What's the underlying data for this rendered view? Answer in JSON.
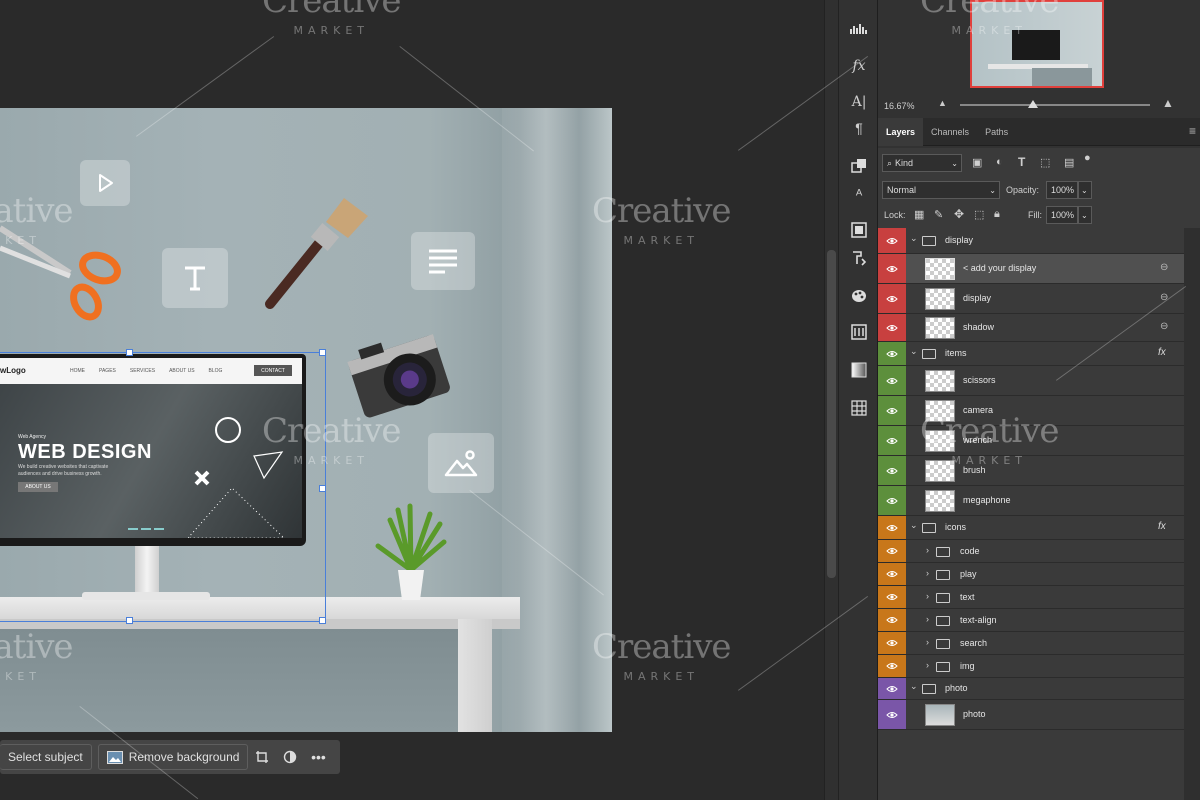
{
  "document": {
    "website": {
      "logo": "wLogo",
      "nav_links": [
        "HOME",
        "PAGES",
        "SERVICES",
        "ABOUT US",
        "BLOG"
      ],
      "contact": "CONTACT",
      "eyebrow": "Web Agency",
      "headline": "WEB DESIGN",
      "subtext": "We build creative websites that captivate audiences and drive business growth.",
      "cta": "ABOUT US"
    },
    "icon_tiles": [
      "play-icon",
      "text-icon",
      "text-align-icon",
      "image-icon"
    ]
  },
  "context_bar": {
    "select_subject": "Select subject",
    "remove_background": "Remove background",
    "more": "•••"
  },
  "watermark": {
    "title": "Creative",
    "sub": "MARKET"
  },
  "navigator": {
    "zoom": "16.67%"
  },
  "panel_tabs": [
    "Layers",
    "Channels",
    "Paths"
  ],
  "filters": {
    "kind": "Kind",
    "blend_mode": "Normal",
    "opacity_label": "Opacity:",
    "opacity": "100%",
    "lock_label": "Lock:",
    "fill_label": "Fill:",
    "fill": "100%"
  },
  "layers": [
    {
      "name": "display",
      "type": "group",
      "color": "#c8403f",
      "expanded": true
    },
    {
      "name": "< add your display",
      "type": "smart",
      "color": "#c8403f",
      "selected": true,
      "linked": true
    },
    {
      "name": "display",
      "type": "layer",
      "color": "#c8403f",
      "linked": true
    },
    {
      "name": "shadow",
      "type": "layer",
      "color": "#c8403f",
      "linked": true
    },
    {
      "name": "items",
      "type": "group",
      "color": "#5d8f3c",
      "expanded": true,
      "fx": "fx"
    },
    {
      "name": "scissors",
      "type": "layer",
      "color": "#5d8f3c"
    },
    {
      "name": "camera",
      "type": "layer",
      "color": "#5d8f3c"
    },
    {
      "name": "wrench",
      "type": "layer",
      "color": "#5d8f3c"
    },
    {
      "name": "brush",
      "type": "layer",
      "color": "#5d8f3c"
    },
    {
      "name": "megaphone",
      "type": "layer",
      "color": "#5d8f3c"
    },
    {
      "name": "icons",
      "type": "group",
      "color": "#c8771a",
      "expanded": true,
      "fx": "fx"
    },
    {
      "name": "code",
      "type": "subgroup",
      "color": "#c8771a"
    },
    {
      "name": "play",
      "type": "subgroup",
      "color": "#c8771a"
    },
    {
      "name": "text",
      "type": "subgroup",
      "color": "#c8771a"
    },
    {
      "name": "text-align",
      "type": "subgroup",
      "color": "#c8771a"
    },
    {
      "name": "search",
      "type": "subgroup",
      "color": "#c8771a"
    },
    {
      "name": "img",
      "type": "subgroup",
      "color": "#c8771a"
    },
    {
      "name": "photo",
      "type": "group",
      "color": "#7a56a8",
      "expanded": true
    },
    {
      "name": "photo",
      "type": "layer",
      "color": "#7a56a8"
    }
  ]
}
